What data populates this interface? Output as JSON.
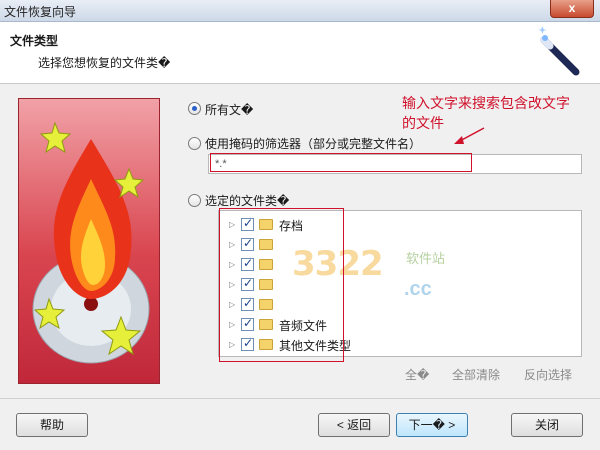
{
  "window": {
    "title": "文件恢复向导",
    "close_label": "x"
  },
  "header": {
    "title": "文件类型",
    "subtitle": "选择您想恢复的文件类�"
  },
  "options": {
    "all_files": "所有文�",
    "mask_filter": "使用掩码的筛选器（部分或完整文件名）",
    "filter_value": "*.*",
    "selected_types": "选定的文件类�"
  },
  "annotation": {
    "line1": "输入文字来搜索包含改文字",
    "line2": "的文件"
  },
  "tree": {
    "items": [
      {
        "label": "存档"
      },
      {
        "label": ""
      },
      {
        "label": ""
      },
      {
        "label": ""
      },
      {
        "label": ""
      },
      {
        "label": "音频文件"
      },
      {
        "label": "其他文件类型"
      }
    ]
  },
  "selection": {
    "select_all": "全�",
    "clear_all": "全部清除",
    "invert": "反向选择"
  },
  "watermark": {
    "digits": "3322",
    "site": "软件站",
    "cc": ".cc"
  },
  "footer": {
    "help": "帮助",
    "back": "< 返回",
    "next": "下一� >",
    "close": "关闭"
  }
}
